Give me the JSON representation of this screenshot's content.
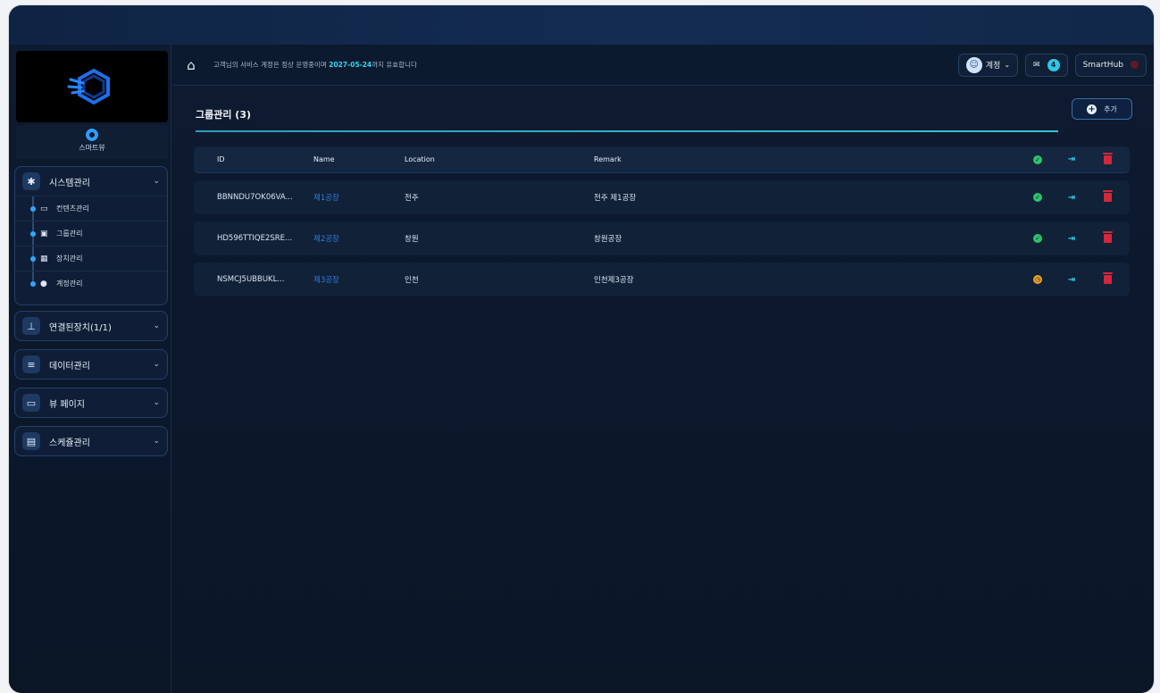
{
  "topbar": {
    "notice_prefix": "고객님의 서비스 계정은 정상 운영중이며 ",
    "notice_date": "2027-05-24",
    "notice_suffix": "까지 유효합니다",
    "account_label": "계정",
    "mail_count": "4",
    "hub_label": "SmartHub"
  },
  "sidebar": {
    "brand_name": "스마트뷰",
    "groups": [
      {
        "label": "시스템관리",
        "icon": "gear-icon",
        "sub": [
          {
            "label": "컨텐츠관리",
            "icon": "window-icon"
          },
          {
            "label": "그룹관리",
            "icon": "group-icon"
          },
          {
            "label": "장치관리",
            "icon": "keyboard-icon"
          },
          {
            "label": "계정관리",
            "icon": "user-icon"
          }
        ]
      },
      {
        "label": "연결된장치(1/1)",
        "icon": "sitemap-icon"
      },
      {
        "label": "데이터관리",
        "icon": "database-icon"
      },
      {
        "label": "뷰 페이지",
        "icon": "monitor-icon"
      },
      {
        "label": "스케쥴관리",
        "icon": "calendar-icon"
      }
    ]
  },
  "main": {
    "title": "그룹관리 (3)",
    "add_label": "추가",
    "columns": [
      "ID",
      "Name",
      "Location",
      "Remark"
    ],
    "rows": [
      {
        "id": "BBNNDU7OK06VA...",
        "name": "제1공장",
        "location": "전주",
        "remark": "전주 제1공장",
        "status": "ok"
      },
      {
        "id": "HD596TTIQE2SRE...",
        "name": "제2공장",
        "location": "창원",
        "remark": "창원공장",
        "status": "ok"
      },
      {
        "id": "NSMCJ5UBBUKL...",
        "name": "제3공장",
        "location": "인천",
        "remark": "인천제3공장",
        "status": "pending"
      }
    ]
  },
  "colors": {
    "accent": "#2ec9e6",
    "ok": "#2ec26a",
    "warn": "#f0a42a",
    "danger": "#d2283b",
    "link": "#2f7ee0"
  }
}
